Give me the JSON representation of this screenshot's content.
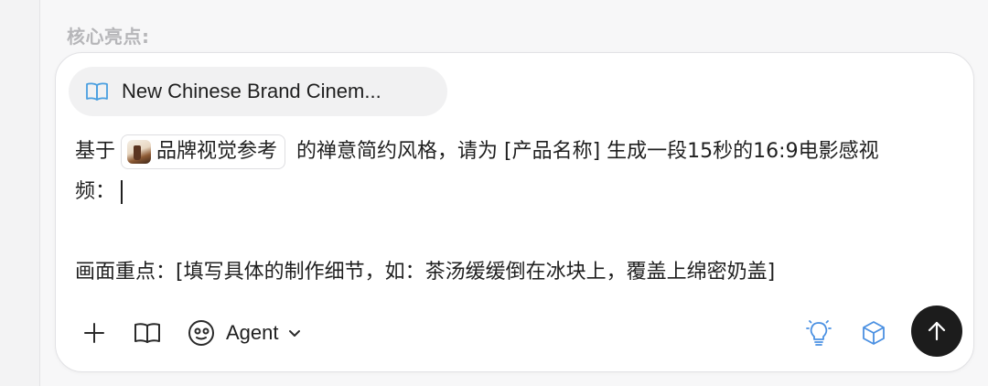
{
  "section": {
    "label": "核心亮点:"
  },
  "reference_chip": {
    "label": "New Chinese Brand Cinem...",
    "icon": "book-open-icon"
  },
  "prompt": {
    "before_tag": "基于",
    "tag_label": "品牌视觉参考",
    "line1_after": "的禅意简约风格，请为 [产品名称] 生成一段15秒的16:9电影感视",
    "line2": "频：",
    "line4": "画面重点：[填写具体的制作细节，如：茶汤缓缓倒在冰块上，覆盖上绵密奶盖]"
  },
  "toolbar": {
    "agent_label": "Agent",
    "icons": [
      "plus-icon",
      "book-icon",
      "agent-face-icon",
      "chevron-down-icon",
      "lightbulb-icon",
      "cube-icon",
      "arrow-up-icon"
    ],
    "accent": "#4a90e2",
    "send_bg": "#1c1c1c"
  }
}
